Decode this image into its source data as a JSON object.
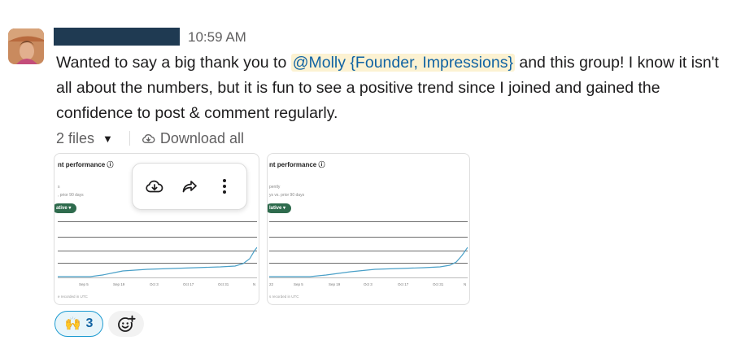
{
  "message": {
    "timestamp": "10:59 AM",
    "text_before": "Wanted to say a big thank you to ",
    "mention": "@Molly {Founder, Impressions}",
    "text_after": " and this group!  I know it isn't all about the numbers, but it is fun to see a positive trend since I joined and gained the confidence to post & comment regularly."
  },
  "files": {
    "count_label": "2 files",
    "download_label": "Download all",
    "items": [
      {
        "title": "nt performance",
        "sub1": "s",
        "sub2": ", prior 90 days",
        "pill": "ative",
        "ticks": [
          "Sep 5",
          "Sep 19",
          "Oct 3",
          "Oct 17",
          "Oct 31",
          "N"
        ],
        "footer": "e recorded in UTC"
      },
      {
        "title": "nt performance",
        "sub1": "pently",
        "sub2": "ys vs. prior 90 days",
        "pill": "lative",
        "ticks": [
          "22",
          "Sep 5",
          "Sep 19",
          "Oct 3",
          "Oct 17",
          "Oct 31",
          "N"
        ],
        "footer": "s recorded in UTC"
      }
    ]
  },
  "hover_menu": {
    "icons": [
      "download-icon",
      "share-icon",
      "more-vertical-icon"
    ]
  },
  "reactions": [
    {
      "emoji": "🙌",
      "icon": "raised-hands-icon",
      "count": "3"
    }
  ],
  "add_reaction_icon": "add-reaction-icon",
  "colors": {
    "mention_bg": "#fcf2d2",
    "mention_text": "#1264a3",
    "pill": "#2e6b4d",
    "line": "#4aa0c8",
    "reaction_border": "#1d9bd1"
  }
}
